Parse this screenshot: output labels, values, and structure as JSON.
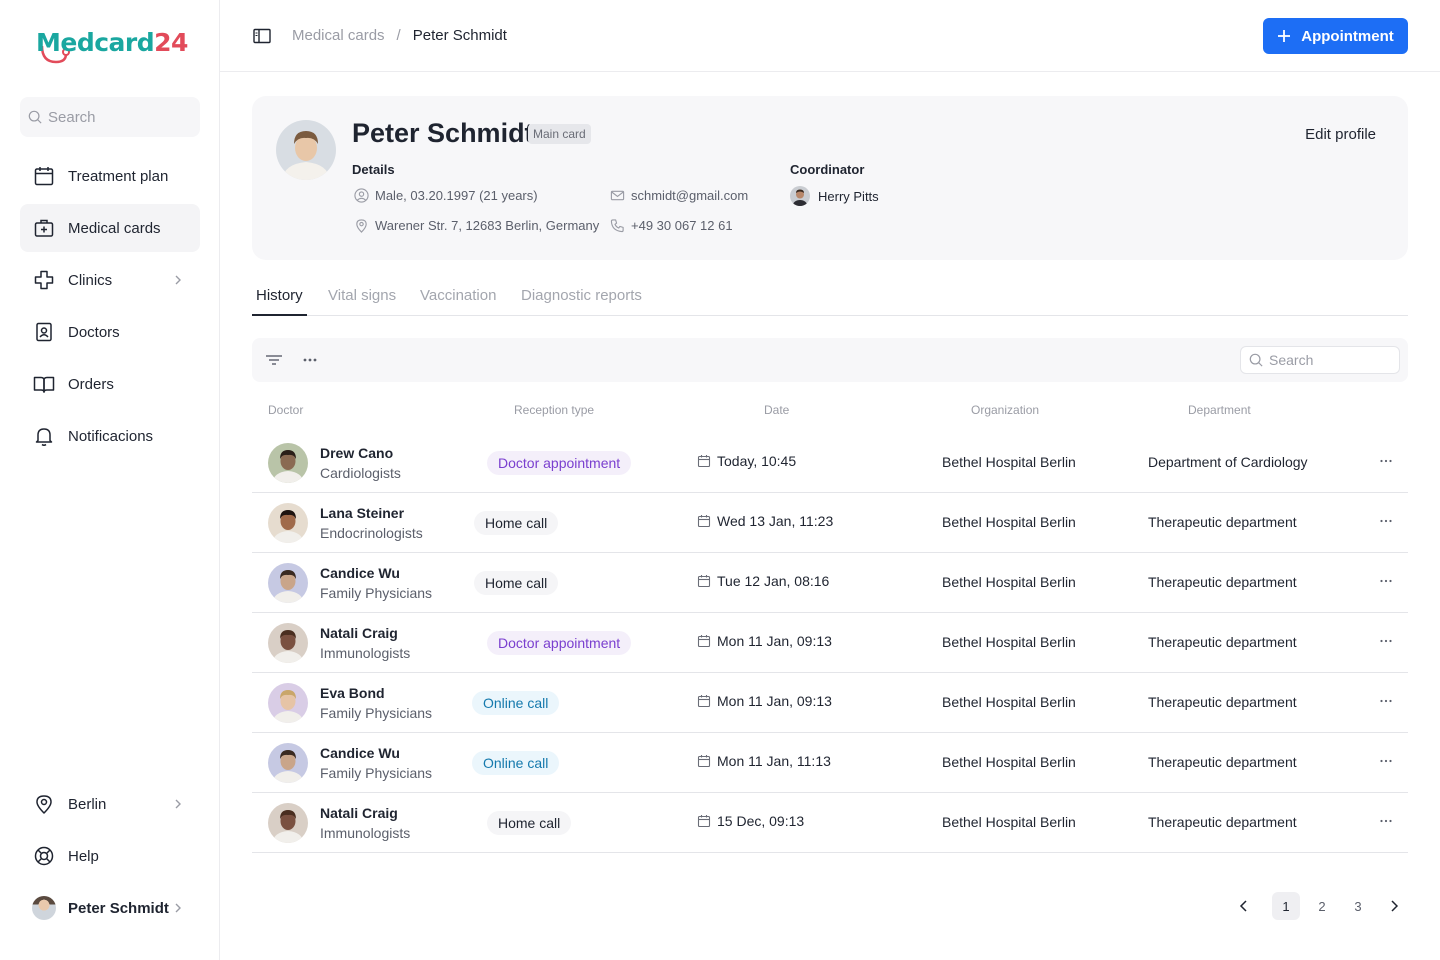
{
  "brand": {
    "logo_text_m": "M",
    "logo_text_rest": "edcard",
    "logo_num": "24",
    "teal": "#1aa7a0",
    "coral": "#e24b5a",
    "accent": "#1d6ef5"
  },
  "sidebar": {
    "search_placeholder": "Search",
    "items": [
      {
        "label": "Treatment plan",
        "icon": "calendar-icon",
        "active": false
      },
      {
        "label": "Medical cards",
        "icon": "medical-case-icon",
        "active": true
      },
      {
        "label": "Clinics",
        "icon": "cross-icon",
        "active": false,
        "chevron": true
      },
      {
        "label": "Doctors",
        "icon": "badge-icon",
        "active": false
      },
      {
        "label": "Orders",
        "icon": "book-icon",
        "active": false
      },
      {
        "label": "Notificacions",
        "icon": "bell-icon",
        "active": false
      }
    ],
    "bottom": [
      {
        "label": "Berlin",
        "icon": "location-icon",
        "chevron": true
      },
      {
        "label": "Help",
        "icon": "lifebuoy-icon"
      },
      {
        "label": "Peter Schmidt",
        "icon": "avatar",
        "chevron": true
      }
    ]
  },
  "topbar": {
    "breadcrumb": [
      "Medical cards",
      "Peter Schmidt"
    ],
    "separator": "/",
    "appointment_label": "Appointment"
  },
  "profile": {
    "name": "Peter Schmidt",
    "badge": "Main card",
    "edit_label": "Edit profile",
    "details_label": "Details",
    "gender_dob": "Male, 03.20.1997 (21 years)",
    "email": "schmidt@gmail.com",
    "address": "Warener Str. 7, 12683 Berlin, Germany",
    "phone": "+49 30 067 12 61",
    "coordinator_label": "Coordinator",
    "coordinator_name": "Herry Pitts"
  },
  "tabs": [
    "History",
    "Vital signs",
    "Vaccination",
    "Diagnostic reports"
  ],
  "toolbar": {
    "search_placeholder": "Search"
  },
  "table": {
    "columns": [
      "Doctor",
      "Reception type",
      "Date",
      "Organization",
      "Department"
    ],
    "rows": [
      {
        "name": "Drew Cano",
        "spec": "Cardiologists",
        "type": "Doctor appointment",
        "kind": "doctor",
        "date": "Today, 10:45",
        "org": "Bethel Hospital Berlin",
        "dept": "Department of Cardiology"
      },
      {
        "name": "Lana Steiner",
        "spec": "Endocrinologists",
        "type": "Home call",
        "kind": "home",
        "date": "Wed 13 Jan, 11:23",
        "org": "Bethel Hospital Berlin",
        "dept": "Therapeutic department"
      },
      {
        "name": "Candice Wu",
        "spec": "Family Physicians",
        "type": "Home call",
        "kind": "home",
        "date": "Tue 12 Jan, 08:16",
        "org": "Bethel Hospital Berlin",
        "dept": "Therapeutic department"
      },
      {
        "name": "Natali Craig",
        "spec": "Immunologists",
        "type": "Doctor appointment",
        "kind": "doctor",
        "date": "Mon 11 Jan, 09:13",
        "org": "Bethel Hospital Berlin",
        "dept": "Therapeutic department"
      },
      {
        "name": "Eva Bond",
        "spec": "Family Physicians",
        "type": "Online call",
        "kind": "online",
        "date": "Mon 11 Jan, 09:13",
        "org": "Bethel Hospital Berlin",
        "dept": "Therapeutic department"
      },
      {
        "name": "Candice Wu",
        "spec": "Family Physicians",
        "type": "Online call",
        "kind": "online",
        "date": "Mon 11 Jan, 11:13",
        "org": "Bethel Hospital Berlin",
        "dept": "Therapeutic department"
      },
      {
        "name": "Natali Craig",
        "spec": "Immunologists",
        "type": "Home call",
        "kind": "home2",
        "date": "15 Dec, 09:13",
        "org": "Bethel Hospital Berlin",
        "dept": "Therapeutic department"
      }
    ]
  },
  "pagination": {
    "pages": [
      "1",
      "2",
      "3"
    ],
    "current": "1"
  }
}
